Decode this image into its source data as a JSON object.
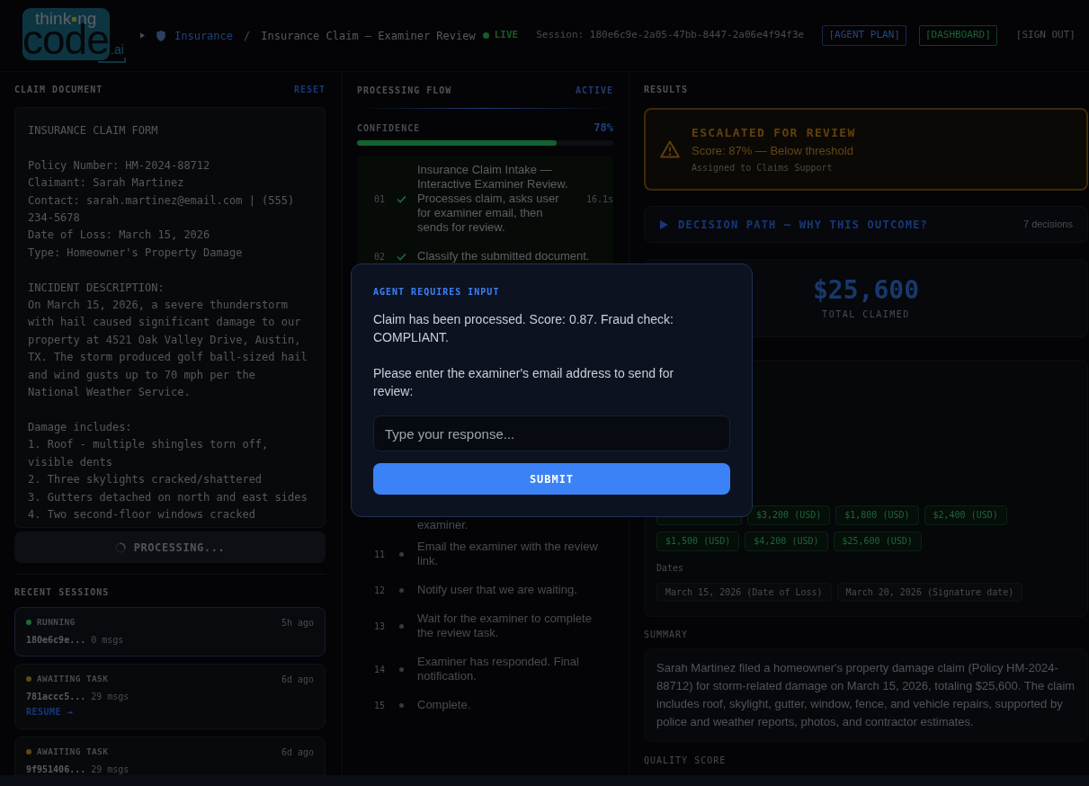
{
  "header": {
    "logo": {
      "top_left": "think",
      "top_right": "ng",
      "main": "code",
      "suffix": ".ai"
    },
    "breadcrumb": {
      "section": "Insurance",
      "divider": "/",
      "title": "Insurance Claim — Examiner Review"
    },
    "live": "LIVE",
    "session": "Session: 180e6c9e-2a05-47bb-8447-2a06e4f94f3e",
    "buttons": [
      {
        "label": "[AGENT PLAN]",
        "kind": "primary"
      },
      {
        "label": "[DASHBOARD]",
        "kind": "success"
      },
      {
        "label": "[SIGN OUT]",
        "kind": "plain"
      }
    ]
  },
  "claim_document": {
    "title": "CLAIM DOCUMENT",
    "reset": "RESET",
    "text": "INSURANCE CLAIM FORM\n\nPolicy Number: HM-2024-88712\nClaimant: Sarah Martinez\nContact: sarah.martinez@email.com | (555) 234-5678\nDate of Loss: March 15, 2026\nType: Homeowner's Property Damage\n\nINCIDENT DESCRIPTION:\nOn March 15, 2026, a severe thunderstorm with hail caused significant damage to our property at 4521 Oak Valley Drive, Austin, TX. The storm produced golf ball-sized hail and wind gusts up to 70 mph per the National Weather Service.\n\nDamage includes:\n1. Roof - multiple shingles torn off, visible dents\n2. Three skylights cracked/shattered\n3. Gutters detached on north and east sides\n4. Two second-floor windows cracked",
    "processing_button": {
      "label": "PROCESSING...",
      "disabled": true
    }
  },
  "recent_sessions": {
    "title": "RECENT SESSIONS",
    "items": [
      {
        "status": "RUNNING",
        "color": "#1e6b34",
        "age": "5h ago",
        "id": "180e6c9e...",
        "messages": "0 msgs",
        "selected": true
      },
      {
        "status": "AWAITING TASK",
        "color": "#5e4a12",
        "age": "6d ago",
        "id": "781accc5...",
        "messages": "29 msgs",
        "action": "RESUME →",
        "selected": false
      },
      {
        "status": "AWAITING TASK",
        "color": "#5e4a12",
        "age": "6d ago",
        "id": "9f951406...",
        "messages": "29 msgs",
        "selected": false
      }
    ]
  },
  "processing_flow": {
    "title": "PROCESSING FLOW",
    "status": "ACTIVE",
    "confidence": {
      "label": "CONFIDENCE",
      "value": "78%",
      "level": 0.78
    },
    "steps": [
      {
        "kind": "step",
        "number": "01",
        "done": true,
        "text": "Insurance Claim Intake — Interactive Examiner Review. Processes claim, asks user for examiner email, then sends for review.",
        "duration": "16.1s"
      },
      {
        "kind": "step",
        "number": "02",
        "done": true,
        "text": "Classify the submitted document."
      },
      {
        "kind": "continuation",
        "text": "examiner."
      },
      {
        "kind": "step",
        "number": "11",
        "done": false,
        "text": "Email the examiner with the review link."
      },
      {
        "kind": "step",
        "number": "12",
        "done": false,
        "text": "Notify user that we are waiting."
      },
      {
        "kind": "step",
        "number": "13",
        "done": false,
        "text": "Wait for the examiner to complete the review task."
      },
      {
        "kind": "step",
        "number": "14",
        "done": false,
        "text": "Examiner has responded. Final notification."
      },
      {
        "kind": "step",
        "number": "15",
        "done": false,
        "text": "Complete."
      }
    ]
  },
  "results": {
    "title": "RESULTS",
    "escalation": {
      "title": "ESCALATED FOR REVIEW",
      "score": "Score: 87% — Below threshold",
      "assignee": "Assigned to Claims Support"
    },
    "decision_path": {
      "label": "DECISION PATH — WHY THIS OUTCOME?",
      "count": "7 decisions",
      "expanded": false
    },
    "total": {
      "amount": "$25,600",
      "label": "TOTAL CLAIMED"
    },
    "amounts": [
      {
        "kind": "covered"
      },
      {
        "kind": "tag",
        "label": "$3,200 (USD)"
      },
      {
        "kind": "tag",
        "label": "$1,800 (USD)"
      },
      {
        "kind": "tag",
        "label": "$2,400 (USD)"
      },
      {
        "kind": "tag",
        "label": "$1,500 (USD)"
      },
      {
        "kind": "tag",
        "label": "$4,200 (USD)"
      },
      {
        "kind": "tag",
        "label": "$25,600 (USD)"
      }
    ],
    "dates": {
      "label": "Dates",
      "items": [
        "March 15, 2026 (Date of Loss)",
        "March 20, 2026 (Signature date)"
      ]
    },
    "summary": {
      "title": "SUMMARY",
      "text": "Sarah Martinez filed a homeowner's property damage claim (Policy HM-2024-88712) for storm-related damage on March 15, 2026, totaling $25,600. The claim includes roof, skylight, gutter, window, fence, and vehicle repairs, supported by police and weather reports, photos, and contractor estimates."
    },
    "quality_score": {
      "title": "QUALITY SCORE"
    }
  },
  "dialog": {
    "title": "AGENT REQUIRES INPUT",
    "paragraphs": [
      "Claim has been processed. Score: 0.87. Fraud check: COMPLIANT.",
      "Please enter the examiner's email address to send for review:"
    ],
    "input": {
      "placeholder": "Type your response..."
    },
    "submit": "SUBMIT"
  }
}
